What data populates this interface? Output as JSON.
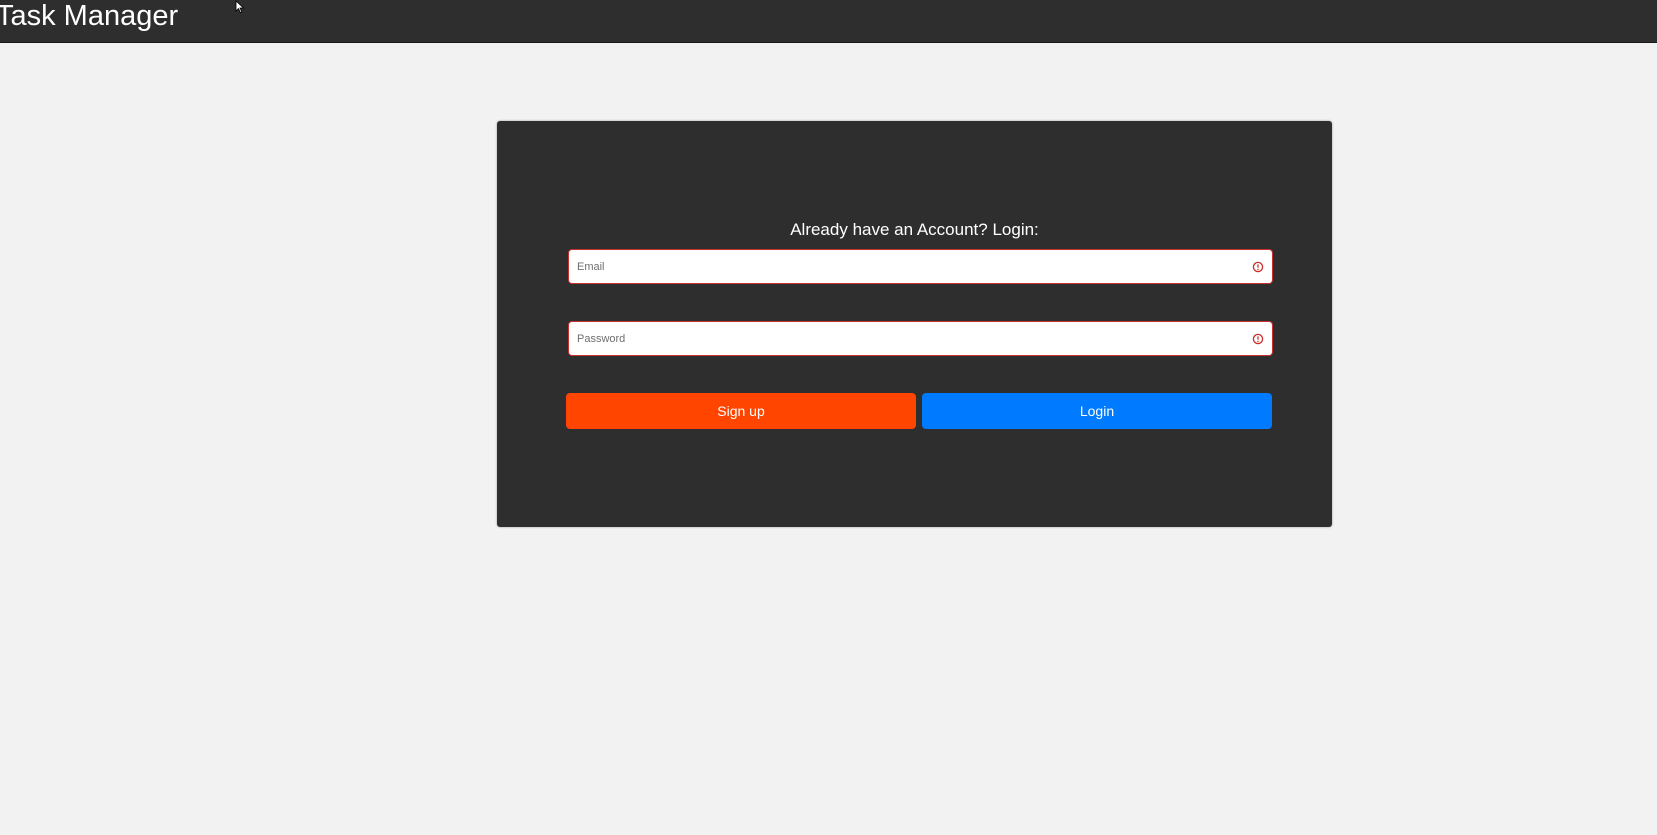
{
  "header": {
    "app_title": "Task Manager"
  },
  "login_card": {
    "heading": "Already have an Account? Login:",
    "email": {
      "placeholder": "Email",
      "value": ""
    },
    "password": {
      "placeholder": "Password",
      "value": ""
    },
    "signup_label": "Sign up",
    "login_label": "Login"
  },
  "colors": {
    "topbar": "#2e2e2e",
    "page_background": "#f2f2f2",
    "card_background": "#2e2e2e",
    "signup_button": "#ff4500",
    "login_button": "#007bff",
    "field_error_border": "#c9302c"
  },
  "icons": {
    "field_status": "alert-circle-icon",
    "cursor": "mouse-cursor-icon"
  }
}
